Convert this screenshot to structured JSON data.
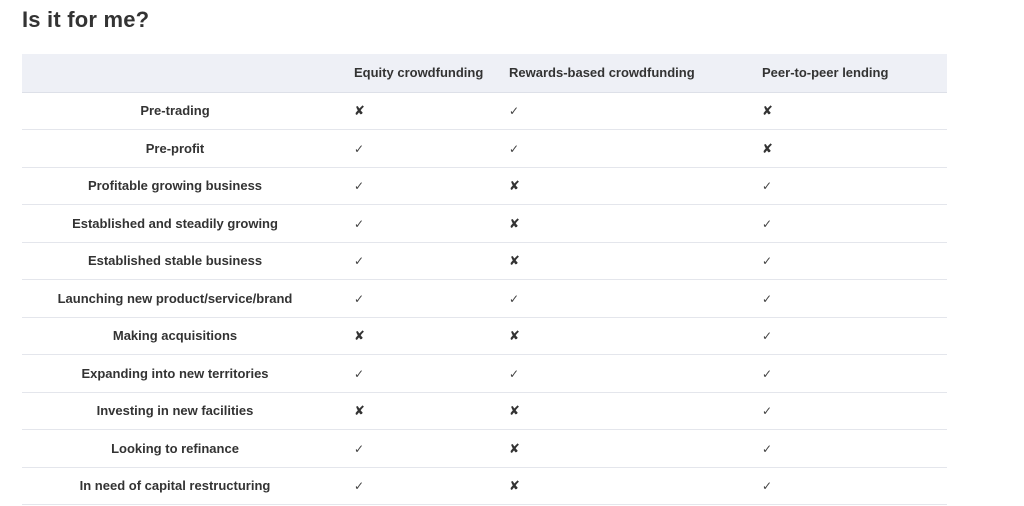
{
  "page": {
    "title": "Is it for me?"
  },
  "table": {
    "headers": [
      "",
      "Equity crowdfunding",
      "Rewards-based crowdfunding",
      "Peer-to-peer lending"
    ],
    "symbols": {
      "yes": "✓",
      "no": "✘"
    },
    "rows": [
      {
        "label": "Pre-trading",
        "values": [
          "no",
          "yes",
          "no"
        ]
      },
      {
        "label": "Pre-profit",
        "values": [
          "yes",
          "yes",
          "no"
        ]
      },
      {
        "label": "Profitable growing business",
        "values": [
          "yes",
          "no",
          "yes"
        ]
      },
      {
        "label": "Established and steadily growing",
        "values": [
          "yes",
          "no",
          "yes"
        ]
      },
      {
        "label": "Established stable business",
        "values": [
          "yes",
          "no",
          "yes"
        ]
      },
      {
        "label": "Launching new product/service/brand",
        "values": [
          "yes",
          "yes",
          "yes"
        ]
      },
      {
        "label": "Making acquisitions",
        "values": [
          "no",
          "no",
          "yes"
        ]
      },
      {
        "label": "Expanding into new territories",
        "values": [
          "yes",
          "yes",
          "yes"
        ]
      },
      {
        "label": "Investing in new facilities",
        "values": [
          "no",
          "no",
          "yes"
        ]
      },
      {
        "label": "Looking to refinance",
        "values": [
          "yes",
          "no",
          "yes"
        ]
      },
      {
        "label": "In need of capital restructuring",
        "values": [
          "yes",
          "no",
          "yes"
        ]
      }
    ]
  },
  "colors": {
    "header_background": "#eef0f6",
    "text": "#333333",
    "row_divider": "#e4e6ec"
  }
}
